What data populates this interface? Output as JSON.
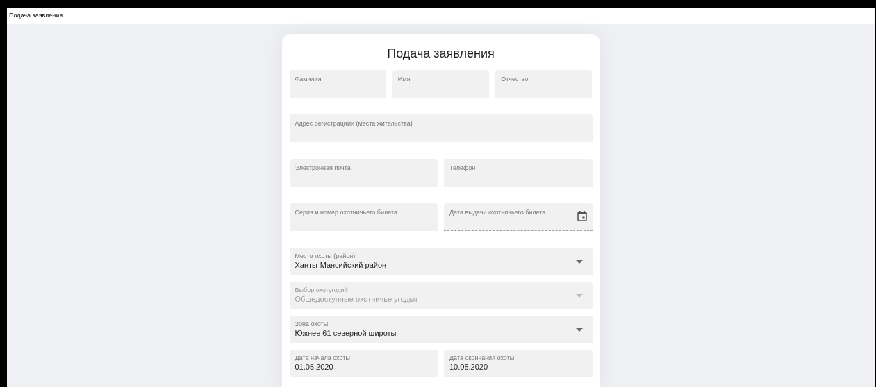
{
  "header": {
    "title": "Подача заявления"
  },
  "form": {
    "title": "Подача заявления",
    "rows": [
      {
        "fields": [
          {
            "kind": "text",
            "label": "Фамилия",
            "disabled": false
          },
          {
            "kind": "text",
            "label": "Имя",
            "disabled": false
          },
          {
            "kind": "text",
            "label": "Отчество",
            "disabled": false
          }
        ]
      },
      {
        "fields": [
          {
            "kind": "text",
            "label": "Адрес регистрациии (места жительства)",
            "disabled": false
          }
        ]
      },
      {
        "fields": [
          {
            "kind": "text",
            "label": "Электронная почта",
            "disabled": false
          },
          {
            "kind": "text",
            "label": "Телефон",
            "disabled": false
          }
        ]
      },
      {
        "fields": [
          {
            "kind": "text",
            "label": "Серия и номер охотничьего билета",
            "disabled": false
          },
          {
            "kind": "date",
            "label": "Дата выдачи охотничьего билета",
            "disabled": false
          }
        ]
      },
      {
        "fields": [
          {
            "kind": "select",
            "label": "Место охоты (район)",
            "value": "Ханты-Мансийский район",
            "disabled": false
          }
        ]
      },
      {
        "fields": [
          {
            "kind": "select",
            "label": "Выбор охотугодий",
            "value": "Общедоступные охотничье угодья",
            "disabled": true
          }
        ]
      },
      {
        "fields": [
          {
            "kind": "select",
            "label": "Зона охоты",
            "value": "Южнее 61 северной широты",
            "disabled": false
          }
        ]
      },
      {
        "fields": [
          {
            "kind": "readonly",
            "label": "Дата начала охоты",
            "value": "01.05.2020",
            "disabled": false
          },
          {
            "kind": "readonly",
            "label": "Дата окончания охоты",
            "value": "10.05.2020",
            "disabled": false
          }
        ]
      }
    ]
  }
}
